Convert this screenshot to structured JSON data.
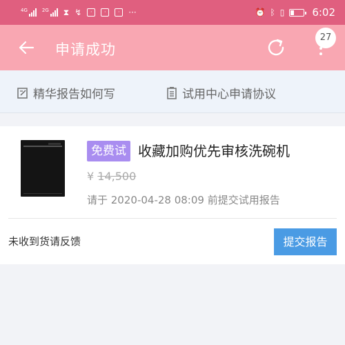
{
  "status_bar": {
    "signal1_label": "4G",
    "signal2_label": "2G",
    "time": "6:02",
    "icons": [
      "signal-icon",
      "signal-icon",
      "hourglass-icon",
      "nfc-icon",
      "app-icon",
      "shield-icon",
      "app-icon",
      "more-dots-icon",
      "alarm-icon",
      "bluetooth-icon",
      "vibrate-icon",
      "battery-icon"
    ]
  },
  "nav": {
    "title": "申请成功",
    "badge_count": "27",
    "bg_color": "#f9a7b2"
  },
  "links": {
    "report_guide": "精华报告如何写",
    "agreement": "试用中心申请协议"
  },
  "product": {
    "badge": "免费试",
    "title": "收藏加购优先审核洗碗机",
    "currency": "¥",
    "price": "14,500",
    "apply_note": "请于 2020-04-28 08:09 前提交试用报告",
    "feedback_label": "未收到货请反馈",
    "submit_label": "提交报告",
    "accent_color": "#4a9be4",
    "badge_color": "#a98df0"
  }
}
